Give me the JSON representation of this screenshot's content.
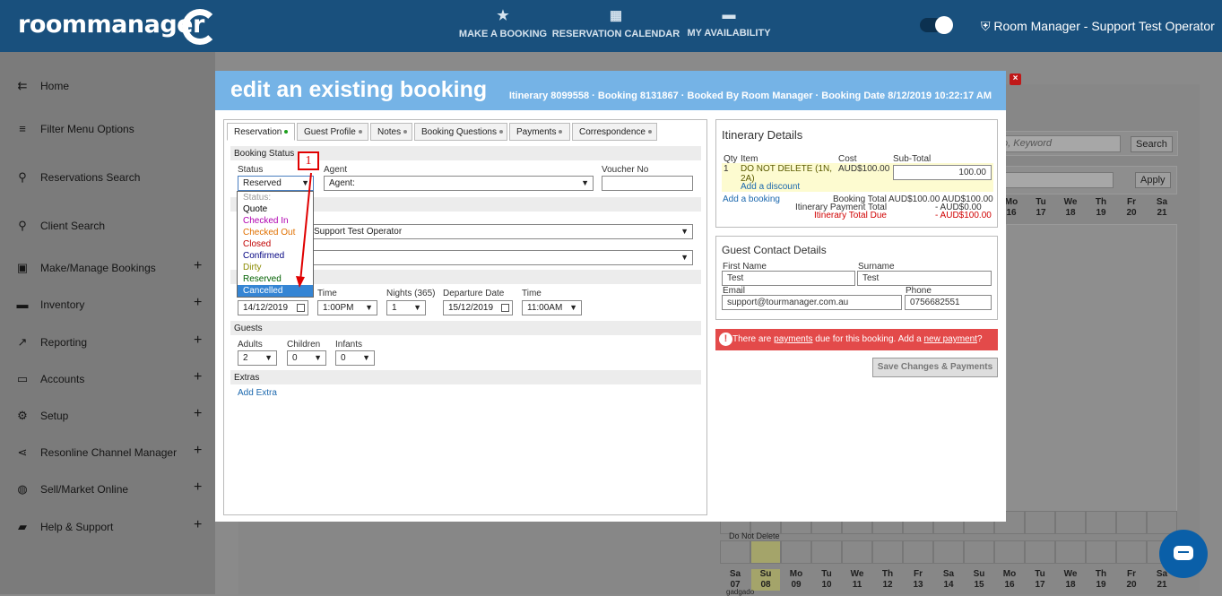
{
  "app": {
    "logo": "roommanager",
    "user": "Room Manager - Support Test Operator"
  },
  "topnav": [
    {
      "label": "MAKE A BOOKING",
      "icon": "star-icon"
    },
    {
      "label": "RESERVATION CALENDAR",
      "icon": "calendar-icon"
    },
    {
      "label": "MY AVAILABILITY",
      "icon": "bed-icon"
    }
  ],
  "sidebar": {
    "items": [
      {
        "label": "Home",
        "icon": "menu-collapse-icon",
        "expandable": false
      },
      {
        "label": "Filter Menu Options",
        "icon": "filter-icon",
        "expandable": false
      },
      {
        "label": "Reservations Search",
        "icon": "search-icon",
        "expandable": false
      },
      {
        "label": "Client Search",
        "icon": "search-icon",
        "expandable": false
      },
      {
        "label": "Make/Manage Bookings",
        "icon": "calendar-check-icon",
        "expandable": true
      },
      {
        "label": "Inventory",
        "icon": "bed-icon",
        "expandable": true
      },
      {
        "label": "Reporting",
        "icon": "trend-chart-icon",
        "expandable": true
      },
      {
        "label": "Accounts",
        "icon": "card-icon",
        "expandable": true
      },
      {
        "label": "Setup",
        "icon": "gear-icon",
        "expandable": true
      },
      {
        "label": "Resonline Channel Manager",
        "icon": "share-icon",
        "expandable": true
      },
      {
        "label": "Sell/Market Online",
        "icon": "globe-icon",
        "expandable": true
      },
      {
        "label": "Help & Support",
        "icon": "chat-icon",
        "expandable": true
      }
    ],
    "plus": "+"
  },
  "background": {
    "search_placeholder": "o, Keyword",
    "search_button": "Search",
    "apply_button": "Apply",
    "days_top": [
      [
        "Mo",
        "16"
      ],
      [
        "Tu",
        "17"
      ],
      [
        "We",
        "18"
      ],
      [
        "Th",
        "19"
      ],
      [
        "Fr",
        "20"
      ],
      [
        "Sa",
        "21"
      ]
    ],
    "days_bottom": [
      [
        "Sa",
        "07"
      ],
      [
        "Su",
        "08"
      ],
      [
        "Mo",
        "09"
      ],
      [
        "Tu",
        "10"
      ],
      [
        "We",
        "11"
      ],
      [
        "Th",
        "12"
      ],
      [
        "Fr",
        "13"
      ],
      [
        "Sa",
        "14"
      ],
      [
        "Su",
        "15"
      ],
      [
        "Mo",
        "16"
      ],
      [
        "Tu",
        "17"
      ],
      [
        "We",
        "18"
      ],
      [
        "Th",
        "19"
      ],
      [
        "Fr",
        "20"
      ],
      [
        "Sa",
        "21"
      ]
    ],
    "do_not_delete": "Do Not Delete",
    "bottom_text": "gadgado"
  },
  "modal": {
    "title": "edit an existing booking",
    "info": "Itinerary 8099558 · Booking 8131867 · Booked By Room Manager · Booking Date 8/12/2019 10:22:17 AM",
    "tabs": [
      "Reservation",
      "Guest Profile",
      "Notes",
      "Booking Questions",
      "Payments",
      "Correspondence"
    ],
    "booking_status": {
      "section": "Booking Status",
      "status_label": "Status",
      "status_value": "Reserved",
      "agent_label": "Agent",
      "agent_value": "Agent:",
      "voucher_label": "Voucher No",
      "voucher_value": ""
    },
    "dropdown": [
      {
        "label": "Status:",
        "color": "#999999"
      },
      {
        "label": "Quote",
        "color": "#000000"
      },
      {
        "label": "Checked In",
        "color": "#b000b0"
      },
      {
        "label": "Checked Out",
        "color": "#e07000"
      },
      {
        "label": "Closed",
        "color": "#c00000"
      },
      {
        "label": "Confirmed",
        "color": "#000080"
      },
      {
        "label": "Dirty",
        "color": "#8a8a00"
      },
      {
        "label": "Reserved",
        "color": "#006000"
      },
      {
        "label": "Cancelled",
        "color": "#ffffff"
      }
    ],
    "annotation": "1",
    "operator_value": "Support Test Operator",
    "second_select_value": "",
    "stay": {
      "time_label": "Time",
      "nights_label": "Nights (365)",
      "departure_label": "Departure Date",
      "time2_label": "Time",
      "arrival_date": "14/12/2019",
      "arrival_time": "1:00PM",
      "nights": "1",
      "departure_date": "15/12/2019",
      "departure_time": "11:00AM"
    },
    "guests": {
      "section": "Guests",
      "adults_label": "Adults",
      "children_label": "Children",
      "infants_label": "Infants",
      "adults": "2",
      "children": "0",
      "infants": "0"
    },
    "extras": {
      "section": "Extras",
      "add_extra": "Add Extra"
    },
    "itinerary": {
      "title": "Itinerary Details",
      "headers": {
        "qty": "Qty",
        "item": "Item",
        "cost": "Cost",
        "subtotal": "Sub-Total"
      },
      "row": {
        "qty": "1",
        "item": "DO NOT DELETE (1N, 2A)",
        "cost": "AUD$100.00",
        "subtotal": "100.00"
      },
      "add_discount": "Add a discount",
      "add_booking": "Add a booking",
      "booking_total_label": "Booking Total",
      "booking_total_values": "AUD$100.00 AUD$100.00",
      "payment_total_label": "Itinerary Payment Total",
      "payment_total_value": "-     AUD$0.00",
      "total_due_label": "Itinerary Total Due",
      "total_due_value": "- AUD$100.00"
    },
    "guest_contact": {
      "title": "Guest Contact Details",
      "first_name_label": "First Name",
      "first_name": "Test",
      "surname_label": "Surname",
      "surname": "Test",
      "email_label": "Email",
      "email": "support@tourmanager.com.au",
      "phone_label": "Phone",
      "phone": "0756682551"
    },
    "alert": {
      "pre": "There are ",
      "link1": "payments",
      "mid": " due for this booking. Add a ",
      "link2": "new payment",
      "post": "?"
    },
    "save_button": "Save Changes & Payments"
  },
  "colors": {
    "topbar": "#19507d",
    "modal_header": "#75b3e6",
    "link": "#1a67ad",
    "alert": "#e34a4a",
    "highlight": "#3585d4"
  }
}
